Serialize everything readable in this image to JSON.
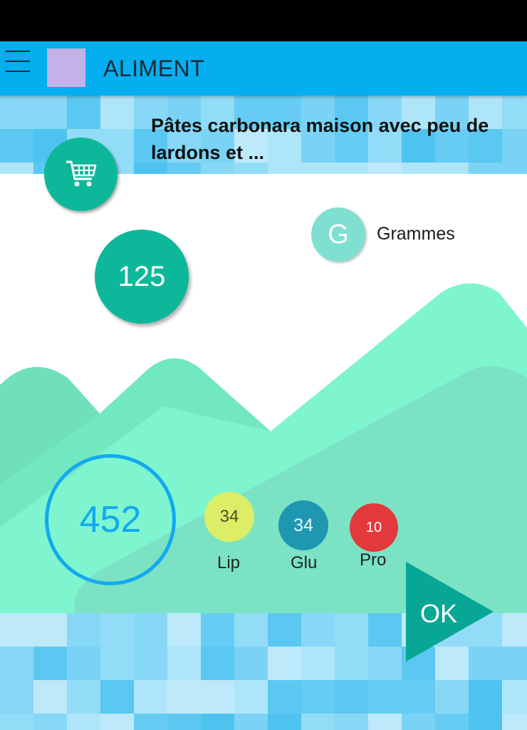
{
  "app": {
    "title": "ALIMENT"
  },
  "header": {
    "menu_icon": "hamburger-menu-icon",
    "avatar_color": "#c3b2e8",
    "bar_color": "#05aeef"
  },
  "food": {
    "title": "Pâtes carbonara maison avec peu de lardons et ..."
  },
  "cart": {
    "icon": "shopping-cart-icon",
    "color": "#0db89a"
  },
  "quantity": {
    "value": "125"
  },
  "unit": {
    "letter": "G",
    "label": "Grammes"
  },
  "calories": {
    "value": "452",
    "color": "#12a9ef"
  },
  "macros": [
    {
      "value": "34",
      "label": "Lip",
      "color": "#dcee68"
    },
    {
      "value": "34",
      "label": "Glu",
      "color": "#1f97b1"
    },
    {
      "value": "10",
      "label": "Pro",
      "color": "#e23a3c"
    }
  ],
  "ok_button": {
    "label": "OK",
    "color": "#08a795"
  }
}
